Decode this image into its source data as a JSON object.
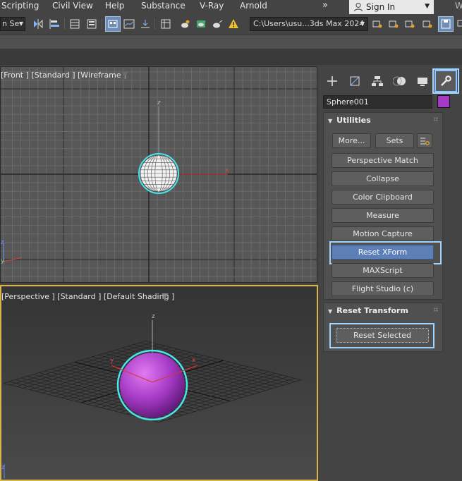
{
  "menu": {
    "items": [
      "Scripting",
      "Civil View",
      "Help",
      "Substance",
      "V-Ray",
      "Arnold"
    ],
    "more": "»",
    "signin": "Sign In",
    "partial_right": "W"
  },
  "toolbar": {
    "selection_filter": "n Se",
    "project_path": "C:\\Users\\usu...3ds Max 2024"
  },
  "viewports": {
    "front": {
      "label": "[Front ] [Standard ] [Wireframe ]",
      "axis_z": "z",
      "axis_x": "x",
      "corner_z": "z",
      "corner_y": "y"
    },
    "perspective": {
      "label": "[Perspective ] [Standard ] [Default Shading ]",
      "axis_z": "z",
      "axis_x": "x",
      "axis_y": "y",
      "corner_z": "z"
    }
  },
  "command_panel": {
    "object_name": "Sphere001",
    "object_color": "#a43ac4",
    "utilities": {
      "title": "Utilities",
      "more_label": "More...",
      "sets_label": "Sets",
      "buttons": [
        "Perspective Match",
        "Collapse",
        "Color Clipboard",
        "Measure",
        "Motion Capture",
        "Reset XForm",
        "MAXScript",
        "Flight Studio (c)"
      ],
      "selected": "Reset XForm"
    },
    "reset_transform": {
      "title": "Reset Transform",
      "button_label": "Reset Selected"
    }
  },
  "colors": {
    "highlight": "#9fd4ff",
    "active_viewport_border": "#d8b54a",
    "selected_button": "#5c7fb8",
    "sphere": "#a43ac4"
  }
}
